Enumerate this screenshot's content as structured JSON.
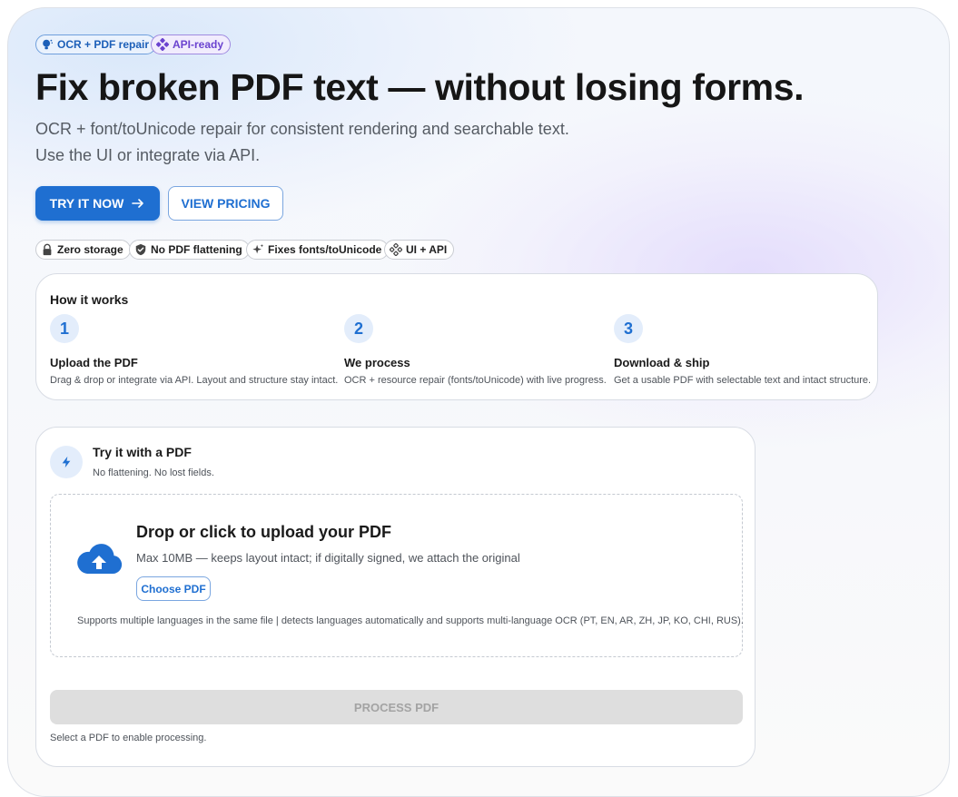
{
  "badges": {
    "ocr": "OCR + PDF repair",
    "api": "API-ready"
  },
  "hero": {
    "title": "Fix broken PDF text — without losing forms.",
    "subtitle_line1": "OCR + font/toUnicode repair for consistent rendering and searchable text.",
    "subtitle_line2": "Use the UI or integrate via API.",
    "try_button": "TRY IT NOW",
    "pricing_button": "VIEW PRICING"
  },
  "features": [
    {
      "label": "Zero storage",
      "icon": "lock-icon"
    },
    {
      "label": "No PDF flattening",
      "icon": "shield-check-icon"
    },
    {
      "label": "Fixes fonts/toUnicode",
      "icon": "sparkle-icon"
    },
    {
      "label": "UI + API",
      "icon": "api-icon"
    }
  ],
  "how_it_works": {
    "title": "How it works",
    "steps": [
      {
        "num": "1",
        "title": "Upload the PDF",
        "desc": "Drag & drop or integrate via API. Layout and structure stay intact."
      },
      {
        "num": "2",
        "title": "We process",
        "desc": "OCR + resource repair (fonts/toUnicode) with live progress."
      },
      {
        "num": "3",
        "title": "Download & ship",
        "desc": "Get a usable PDF with selectable text and intact structure."
      }
    ]
  },
  "try_card": {
    "title": "Try it with a PDF",
    "subtitle": "No flattening. No lost fields.",
    "drop_title": "Drop or click to upload your PDF",
    "drop_subtitle": "Max 10MB — keeps layout intact; if digitally signed, we attach the original",
    "choose_button": "Choose PDF",
    "languages_note": "Supports multiple languages in the same file | detects languages automatically and supports multi-language OCR (PT, EN, AR, ZH, JP, KO, CHI, RUS).",
    "process_button": "PROCESS PDF",
    "hint": "Select a PDF to enable processing."
  },
  "colors": {
    "primary": "#1f6fd1",
    "purple": "#6a43cf",
    "disabled_bg": "#dedede"
  }
}
